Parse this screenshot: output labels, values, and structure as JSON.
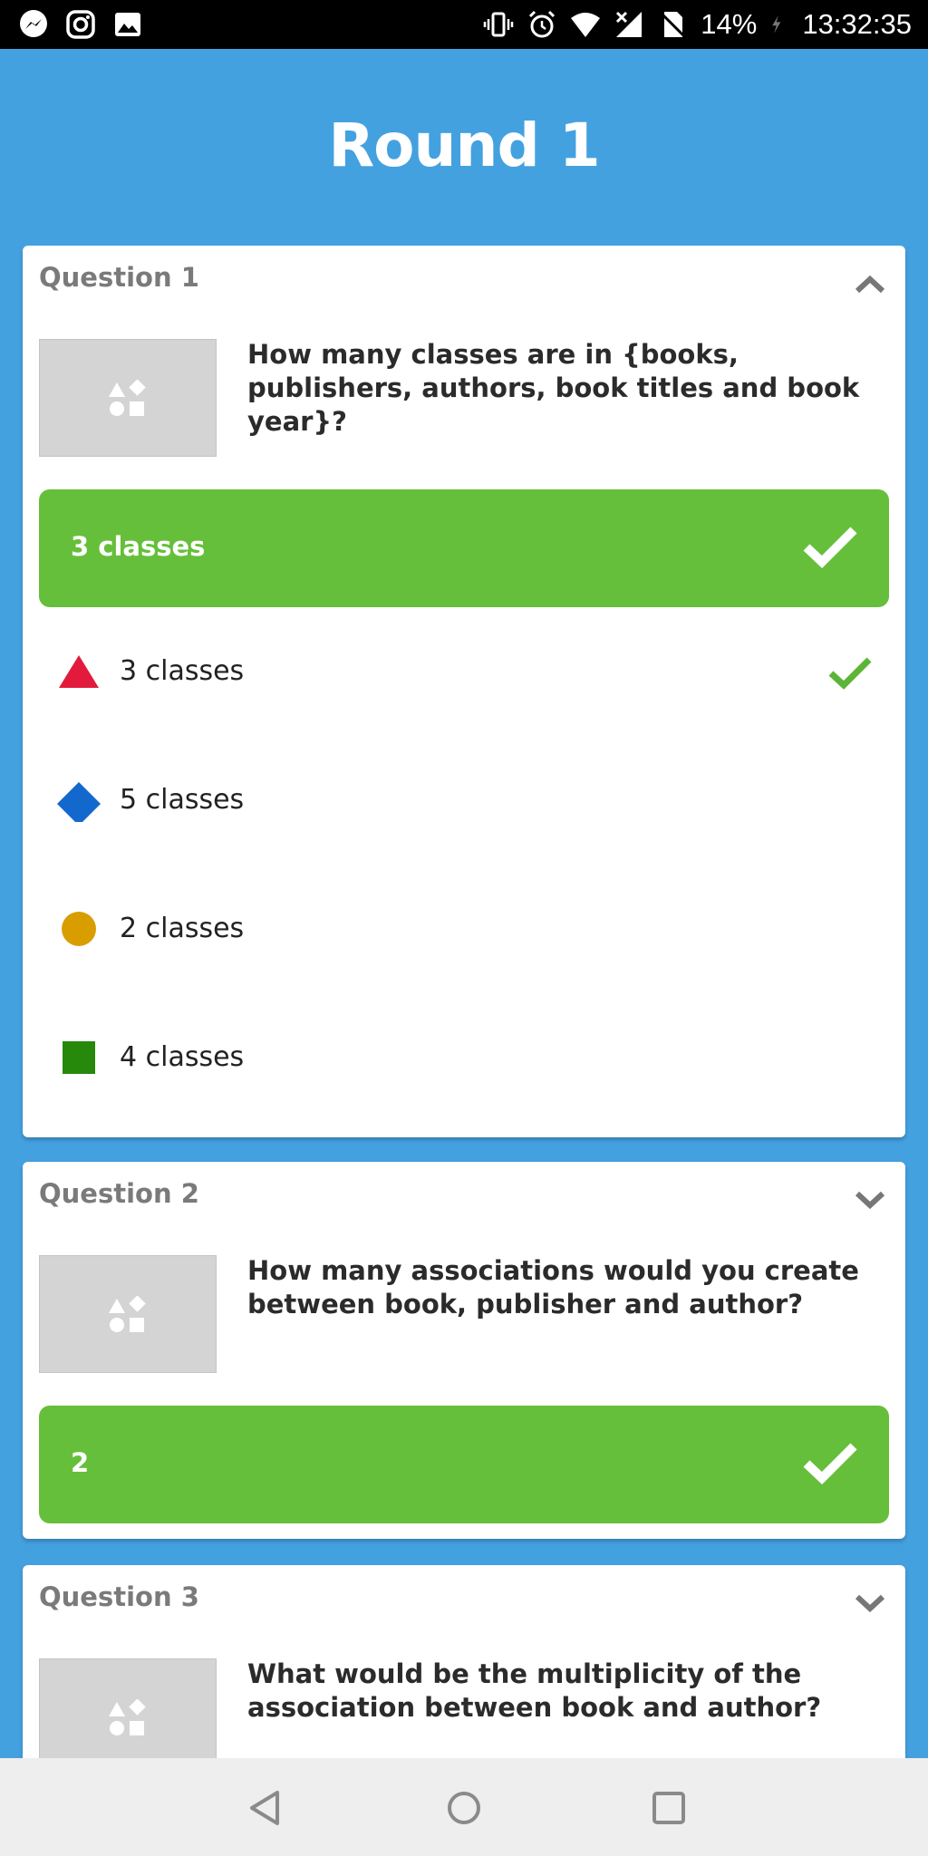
{
  "status_bar": {
    "battery": "14%",
    "time": "13:32:35",
    "left_icons": [
      "messenger-icon",
      "instagram-icon",
      "gallery-icon"
    ],
    "right_icons": [
      "vibrate-icon",
      "alarm-icon",
      "wifi-icon",
      "signal-icon",
      "no-sim-icon",
      "charging-icon"
    ]
  },
  "header": {
    "title": "Round 1"
  },
  "questions": [
    {
      "label": "Question 1",
      "text": "How many classes are in {books, publishers, authors, book titles and book year}?",
      "answer": "3 classes",
      "expanded": true,
      "options": [
        {
          "shape": "triangle",
          "color": "#e21b3c",
          "label": "3 classes",
          "correct": true
        },
        {
          "shape": "diamond",
          "color": "#1368ce",
          "label": "5 classes",
          "correct": false
        },
        {
          "shape": "circle",
          "color": "#d89e00",
          "label": "2 classes",
          "correct": false
        },
        {
          "shape": "square",
          "color": "#26890c",
          "label": "4 classes",
          "correct": false
        }
      ]
    },
    {
      "label": "Question 2",
      "text": "How many associations would you create between book, publisher and author?",
      "answer": "2",
      "expanded": false
    },
    {
      "label": "Question 3",
      "text": "What would be the multiplicity of the association between book and author?",
      "expanded": false
    }
  ],
  "colors": {
    "background": "#44a1e0",
    "correct_green": "#66bf3a",
    "check_green": "#5cb536"
  },
  "nav": [
    "back-icon",
    "home-icon",
    "recents-icon"
  ]
}
